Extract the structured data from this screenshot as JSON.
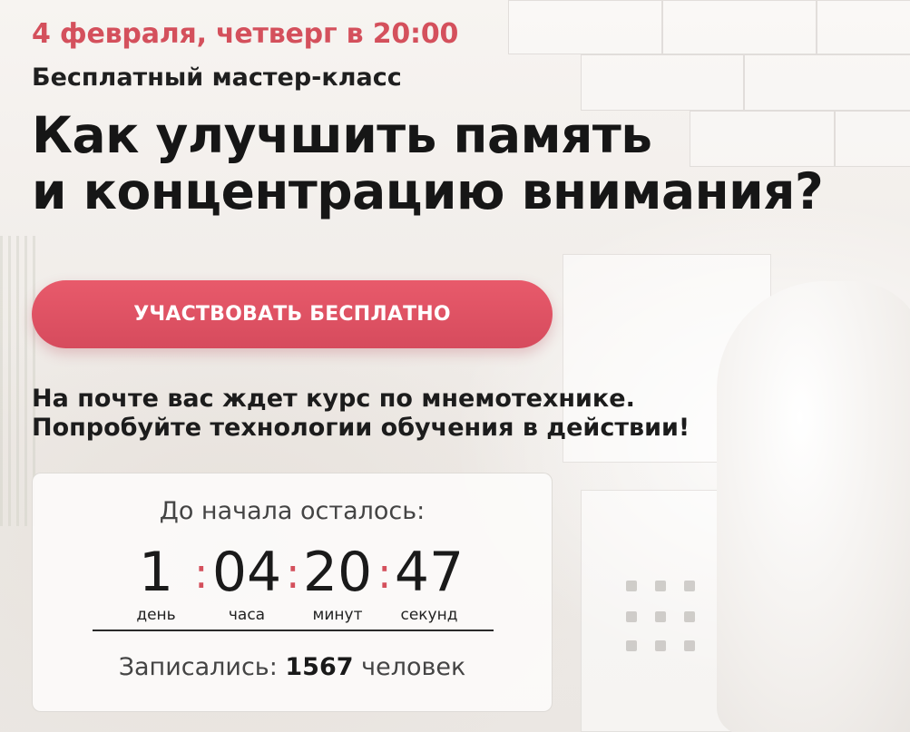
{
  "header": {
    "date": "4 февраля, четверг в 20:00",
    "subtitle": "Бесплатный мастер-класс",
    "headline_line1": "Как улучшить память",
    "headline_line2": "и концентрацию внимания?"
  },
  "cta": {
    "label": "УЧАСТВОВАТЬ БЕСПЛАТНО"
  },
  "info": {
    "line1": "На почте вас ждет курс по мнемотехнике.",
    "line2": "Попробуйте технологии обучения в действии!"
  },
  "timer": {
    "title": "До начала осталось:",
    "separator": ":",
    "days": {
      "value": "1",
      "label": "день"
    },
    "hours": {
      "value": "04",
      "label": "часа"
    },
    "minutes": {
      "value": "20",
      "label": "минут"
    },
    "seconds": {
      "value": "47",
      "label": "секунд"
    },
    "signed_prefix": "Записались:",
    "signed_count": "1567",
    "signed_suffix": "человек"
  },
  "colors": {
    "accent": "#d4505c",
    "button": "#e0566a",
    "text": "#1c1c1c"
  }
}
